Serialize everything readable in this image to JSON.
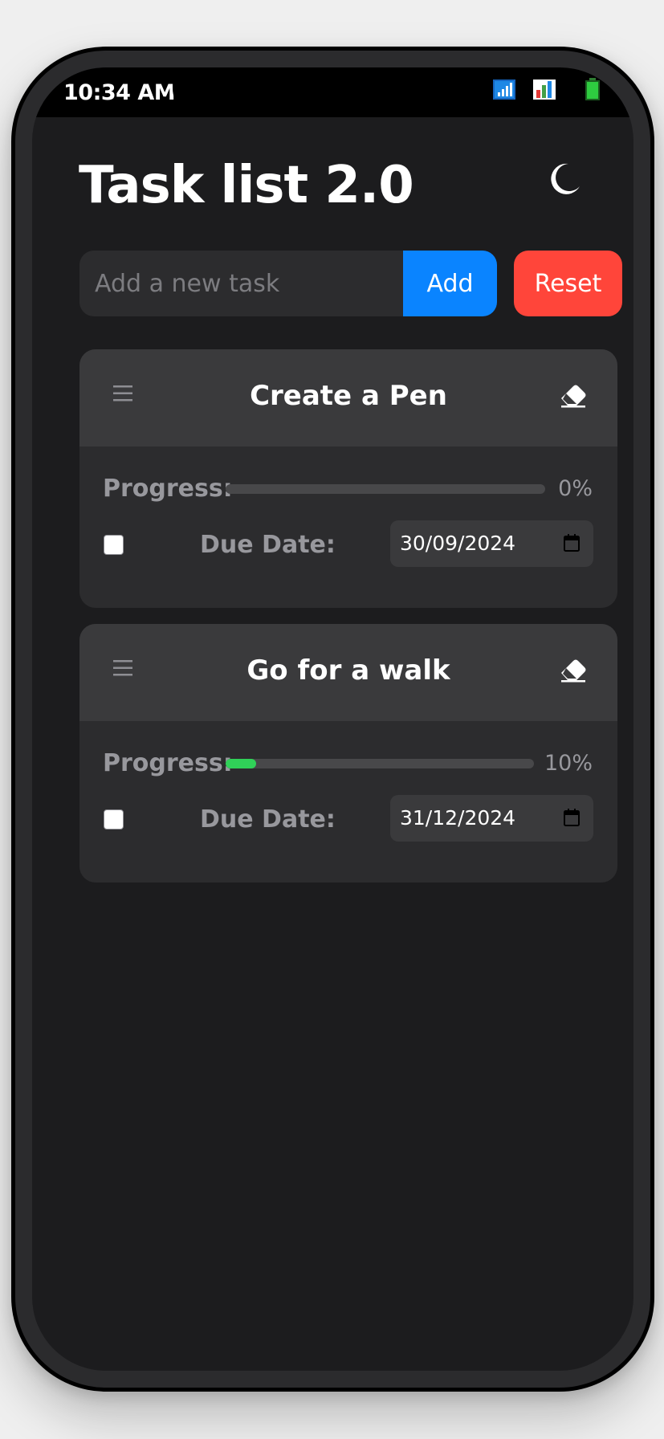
{
  "status_bar": {
    "time": "10:34 AM",
    "icons": [
      "network-icon",
      "signal-icon",
      "battery-icon"
    ]
  },
  "app": {
    "title": "Task list 2.0",
    "theme_toggle_icon": "moon-icon"
  },
  "new_task": {
    "placeholder": "Add a new task",
    "value": "",
    "add_label": "Add",
    "reset_label": "Reset"
  },
  "tasks": [
    {
      "name": "Create a Pen",
      "progress_label": "Progress:",
      "progress": 0,
      "progress_text": "0%",
      "completed": false,
      "due_label": "Due Date:",
      "due_date": "30/09/2024"
    },
    {
      "name": "Go for a walk",
      "progress_label": "Progress:",
      "progress": 10,
      "progress_text": "10%",
      "completed": false,
      "due_label": "Due Date:",
      "due_date": "31/12/2024"
    }
  ],
  "colors": {
    "background": "#1c1c1e",
    "card": "#2c2c2e",
    "card_header": "#3a3a3c",
    "accent_add": "#0a84ff",
    "accent_reset": "#ff453a",
    "progress_fill": "#30d158"
  }
}
